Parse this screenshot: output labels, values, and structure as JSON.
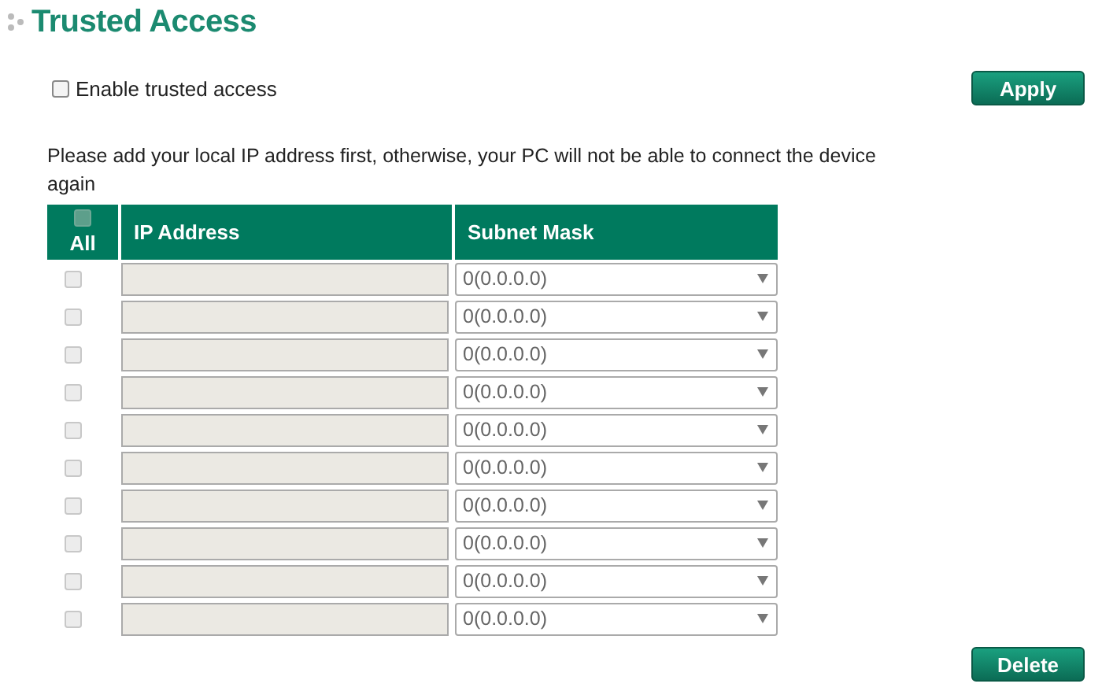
{
  "title": "Trusted Access",
  "enable": {
    "label": "Enable trusted access",
    "checked": false
  },
  "apply_button": "Apply",
  "notice": "Please add your local IP address first, otherwise, your PC will not be able to connect the device again",
  "table": {
    "columns": [
      "All",
      "IP Address",
      "Subnet Mask"
    ],
    "select_all": {
      "checked": false,
      "disabled": true
    },
    "rows": [
      {
        "checked": false,
        "disabled": true,
        "ip": "",
        "mask": "0(0.0.0.0)"
      },
      {
        "checked": false,
        "disabled": true,
        "ip": "",
        "mask": "0(0.0.0.0)"
      },
      {
        "checked": false,
        "disabled": true,
        "ip": "",
        "mask": "0(0.0.0.0)"
      },
      {
        "checked": false,
        "disabled": true,
        "ip": "",
        "mask": "0(0.0.0.0)"
      },
      {
        "checked": false,
        "disabled": true,
        "ip": "",
        "mask": "0(0.0.0.0)"
      },
      {
        "checked": false,
        "disabled": true,
        "ip": "",
        "mask": "0(0.0.0.0)"
      },
      {
        "checked": false,
        "disabled": true,
        "ip": "",
        "mask": "0(0.0.0.0)"
      },
      {
        "checked": false,
        "disabled": true,
        "ip": "",
        "mask": "0(0.0.0.0)"
      },
      {
        "checked": false,
        "disabled": true,
        "ip": "",
        "mask": "0(0.0.0.0)"
      },
      {
        "checked": false,
        "disabled": true,
        "ip": "",
        "mask": "0(0.0.0.0)"
      }
    ]
  },
  "delete_button": "Delete"
}
